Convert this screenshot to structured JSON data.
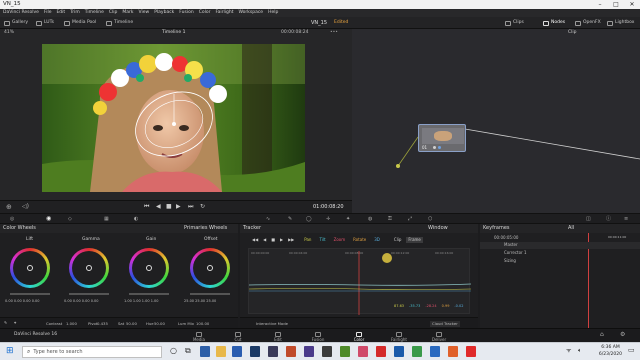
{
  "window": {
    "title": "VN_15"
  },
  "menu": [
    "DaVinci Resolve",
    "File",
    "Edit",
    "Trim",
    "Timeline",
    "Clip",
    "Mark",
    "View",
    "Playback",
    "Fusion",
    "Color",
    "Fairlight",
    "Workspace",
    "Help"
  ],
  "toolbar": {
    "gallery": "Gallery",
    "luts": "LUTs",
    "media_pool": "Media Pool",
    "timeline": "Timeline",
    "project": "VN_15",
    "status": "Edited",
    "clips": "Clips",
    "nodes": "Nodes",
    "openfx": "OpenFX",
    "lightbox": "Lightbox"
  },
  "viewer": {
    "zoom": "41%",
    "timeline_name": "Timeline 1",
    "tc_top": "00:00:08:24",
    "timecode": "01:00:08:20",
    "clip_label": "Clip"
  },
  "node": {
    "label": "01"
  },
  "panels": {
    "color_wheels": "Color Wheels",
    "primaries": "Primaries Wheels",
    "tracker": "Tracker",
    "window": "Window",
    "keyframes": "Keyframes",
    "all": "All"
  },
  "wheels": [
    {
      "name": "Lift",
      "vals": "0.00  0.00  0.00  0.00"
    },
    {
      "name": "Gamma",
      "vals": "0.00  0.00  0.00  0.00"
    },
    {
      "name": "Gain",
      "vals": "1.00  1.00  1.00  1.00"
    },
    {
      "name": "Offset",
      "vals": "25.00  25.00  25.00"
    }
  ],
  "adjust": {
    "contrast_label": "Contrast",
    "contrast": "1.000",
    "pivot_label": "Pivot",
    "pivot": "0.435",
    "sat_label": "Sat",
    "sat": "50.00",
    "hue_label": "Hue",
    "hue": "50.00",
    "lum_label": "Lum Mix",
    "lum": "100.00"
  },
  "tracker": {
    "checks": [
      "Pan",
      "Tilt",
      "Zoom",
      "Rotate",
      "3D"
    ],
    "clip": "Clip",
    "frame": "Frame",
    "ruler": [
      "00:00:00:00",
      "00:00:04:00",
      "00:00:08:00",
      "00:00:12:00",
      "00:00:16:00"
    ],
    "values": [
      "87.63",
      "-35.73",
      "-28.24",
      "0.99",
      "-0.02"
    ],
    "interactive": "Interactive Mode",
    "cloud": "Cloud Tracker"
  },
  "keyframes": {
    "tc": "00:00:05:00",
    "tc2": "00:00:11:00",
    "rows": [
      "Master",
      "Corrector 1",
      "Sizing"
    ]
  },
  "pages": [
    "Media",
    "Cut",
    "Edit",
    "Fusion",
    "Color",
    "Fairlight",
    "Deliver"
  ],
  "active_page": "Color",
  "app_name": "DaVinci Resolve 16",
  "taskbar": {
    "search": "Type here to search",
    "time": "6:36 AM",
    "date": "6/23/2020"
  }
}
